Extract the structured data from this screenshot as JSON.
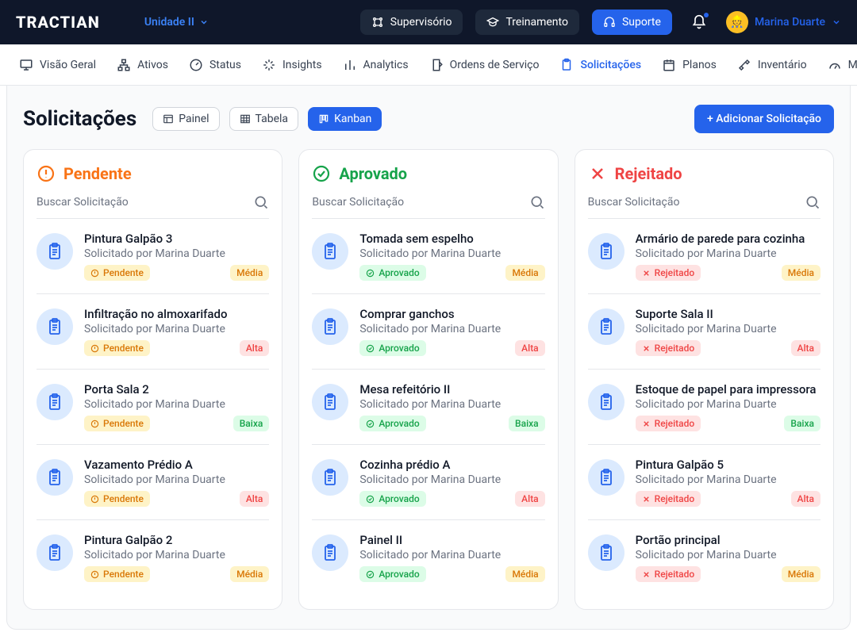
{
  "brand": "TRACTIAN",
  "unit": "Unidade II",
  "topNav": {
    "supervisorio": "Supervisório",
    "treinamento": "Treinamento",
    "suporte": "Suporte"
  },
  "user": "Marina Duarte",
  "tabs": {
    "visaoGeral": "Visão Geral",
    "ativos": "Ativos",
    "status": "Status",
    "insights": "Insights",
    "analytics": "Analytics",
    "ordens": "Ordens de Serviço",
    "solicitacoes": "Solicitações",
    "planos": "Planos",
    "inventario": "Inventário",
    "metricas": "Métricas"
  },
  "page": {
    "title": "Solicitações",
    "views": {
      "painel": "Painel",
      "tabela": "Tabela",
      "kanban": "Kanban"
    },
    "addBtn": "+ Adicionar Solicitação"
  },
  "search": {
    "placeholder": "Buscar Solicitação"
  },
  "requesterPrefix": "Solicitado por ",
  "statusLabels": {
    "pendente": "Pendente",
    "aprovado": "Aprovado",
    "rejeitado": "Rejeitado"
  },
  "priorityLabels": {
    "media": "Média",
    "alta": "Alta",
    "baixa": "Baixa"
  },
  "columns": [
    {
      "key": "pendente",
      "title": "Pendente",
      "cards": [
        {
          "title": "Pintura Galpão 3",
          "requester": "Marina Duarte",
          "status": "pendente",
          "priority": "media"
        },
        {
          "title": "Infiltração no almoxarifado",
          "requester": "Marina Duarte",
          "status": "pendente",
          "priority": "alta"
        },
        {
          "title": "Porta Sala 2",
          "requester": "Marina Duarte",
          "status": "pendente",
          "priority": "baixa"
        },
        {
          "title": "Vazamento Prédio A",
          "requester": "Marina Duarte",
          "status": "pendente",
          "priority": "alta"
        },
        {
          "title": "Pintura Galpão 2",
          "requester": "Marina Duarte",
          "status": "pendente",
          "priority": "media"
        }
      ]
    },
    {
      "key": "aprovado",
      "title": "Aprovado",
      "cards": [
        {
          "title": "Tomada sem espelho",
          "requester": "Marina Duarte",
          "status": "aprovado",
          "priority": "media"
        },
        {
          "title": "Comprar ganchos",
          "requester": "Marina Duarte",
          "status": "aprovado",
          "priority": "alta"
        },
        {
          "title": "Mesa refeitório II",
          "requester": "Marina Duarte",
          "status": "aprovado",
          "priority": "baixa"
        },
        {
          "title": "Cozinha prédio A",
          "requester": "Marina Duarte",
          "status": "aprovado",
          "priority": "alta"
        },
        {
          "title": "Painel II",
          "requester": "Marina Duarte",
          "status": "aprovado",
          "priority": "media"
        }
      ]
    },
    {
      "key": "rejeitado",
      "title": "Rejeitado",
      "cards": [
        {
          "title": "Armário de parede para cozinha",
          "requester": "Marina Duarte",
          "status": "rejeitado",
          "priority": "media"
        },
        {
          "title": "Suporte Sala II",
          "requester": "Marina Duarte",
          "status": "rejeitado",
          "priority": "alta"
        },
        {
          "title": "Estoque de papel para impressora",
          "requester": "Marina Duarte",
          "status": "rejeitado",
          "priority": "baixa"
        },
        {
          "title": "Pintura Galpão 5",
          "requester": "Marina Duarte",
          "status": "rejeitado",
          "priority": "alta"
        },
        {
          "title": "Portão principal",
          "requester": "Marina Duarte",
          "status": "rejeitado",
          "priority": "media"
        }
      ]
    }
  ]
}
